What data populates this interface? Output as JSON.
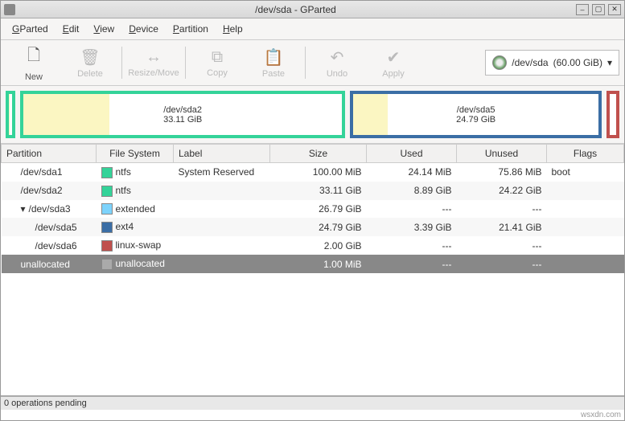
{
  "window": {
    "title": "/dev/sda - GParted"
  },
  "menu": {
    "gparted": "GParted",
    "edit": "Edit",
    "view": "View",
    "device": "Device",
    "partition": "Partition",
    "help": "Help"
  },
  "toolbar": {
    "new": "New",
    "delete": "Delete",
    "resize": "Resize/Move",
    "copy": "Copy",
    "paste": "Paste",
    "undo": "Undo",
    "apply": "Apply"
  },
  "device_selector": {
    "device": "/dev/sda",
    "size": "(60.00 GiB)"
  },
  "partmap": {
    "sda2": {
      "name": "/dev/sda2",
      "size": "33.11 GiB",
      "used_pct": 27
    },
    "sda5": {
      "name": "/dev/sda5",
      "size": "24.79 GiB",
      "used_pct": 14
    }
  },
  "columns": {
    "partition": "Partition",
    "fs": "File System",
    "label": "Label",
    "size": "Size",
    "used": "Used",
    "unused": "Unused",
    "flags": "Flags"
  },
  "rows": [
    {
      "name": "/dev/sda1",
      "fs": "ntfs",
      "label": "System Reserved",
      "size": "100.00 MiB",
      "used": "24.14 MiB",
      "unused": "75.86 MiB",
      "flags": "boot",
      "swatch": "sw-ntfs",
      "indent": "indent1"
    },
    {
      "name": "/dev/sda2",
      "fs": "ntfs",
      "label": "",
      "size": "33.11 GiB",
      "used": "8.89 GiB",
      "unused": "24.22 GiB",
      "flags": "",
      "swatch": "sw-ntfs",
      "indent": "indent1"
    },
    {
      "name": "/dev/sda3",
      "fs": "extended",
      "label": "",
      "size": "26.79 GiB",
      "used": "---",
      "unused": "---",
      "flags": "",
      "swatch": "sw-ext",
      "indent": "indent1",
      "expander": "▾"
    },
    {
      "name": "/dev/sda5",
      "fs": "ext4",
      "label": "",
      "size": "24.79 GiB",
      "used": "3.39 GiB",
      "unused": "21.41 GiB",
      "flags": "",
      "swatch": "sw-ext4",
      "indent": "indent2"
    },
    {
      "name": "/dev/sda6",
      "fs": "linux-swap",
      "label": "",
      "size": "2.00 GiB",
      "used": "---",
      "unused": "---",
      "flags": "",
      "swatch": "sw-swap",
      "indent": "indent2"
    },
    {
      "name": "unallocated",
      "fs": "unallocated",
      "label": "",
      "size": "1.00 MiB",
      "used": "---",
      "unused": "---",
      "flags": "",
      "swatch": "sw-unalloc",
      "indent": "indent1",
      "selected": true
    }
  ],
  "status": {
    "pending": "0 operations pending"
  },
  "watermark": "wsxdn.com"
}
